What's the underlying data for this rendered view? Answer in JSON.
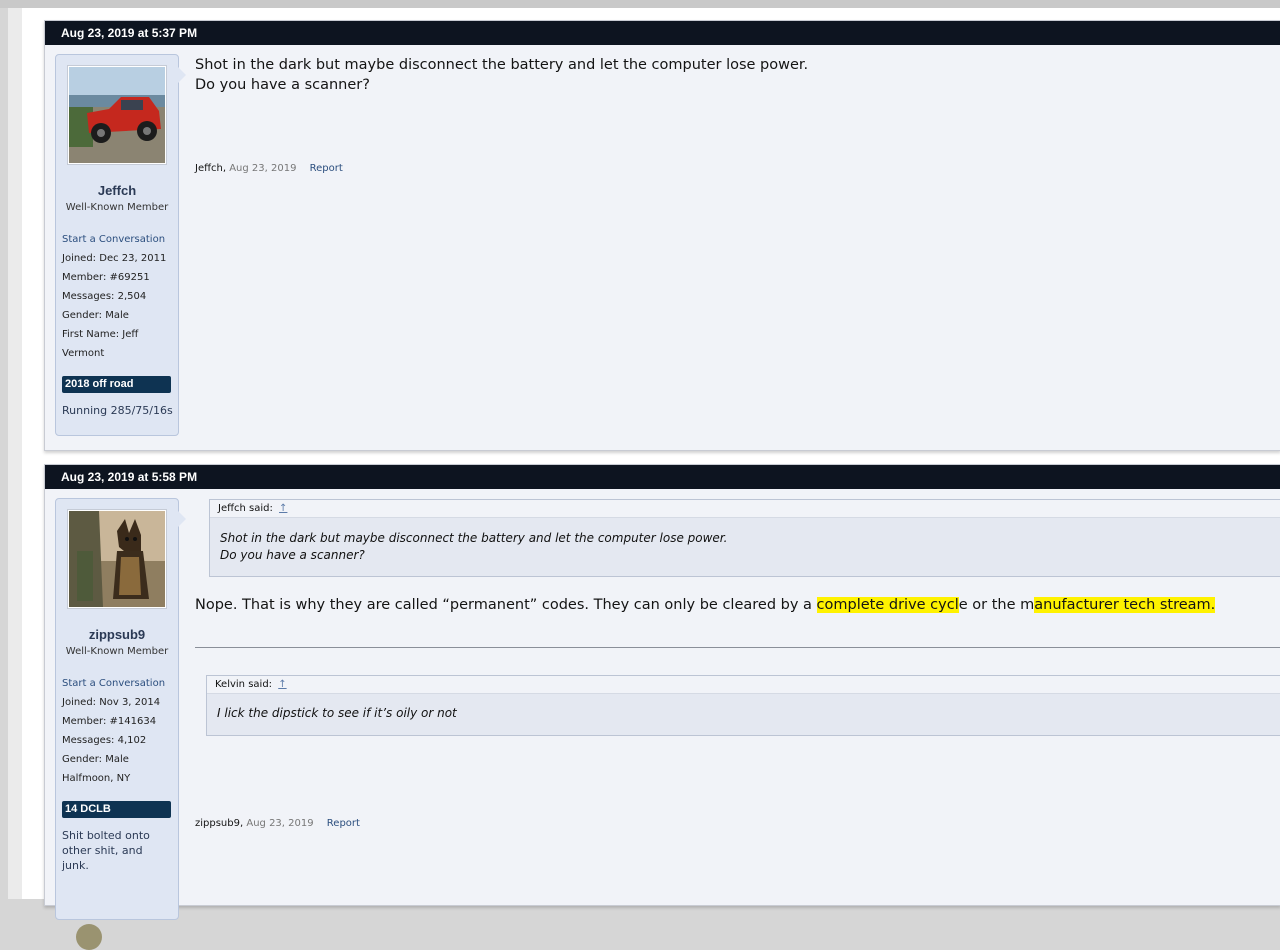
{
  "post1": {
    "timestamp": "Aug 23, 2019 at 5:37 PM",
    "user": {
      "name": "Jeffch",
      "title": "Well-Known Member",
      "start_conversation": "Start a Conversation",
      "fields": [
        {
          "label": "Joined:",
          "value": "Dec 23, 2011"
        },
        {
          "label": "Member:",
          "value": "#69251"
        },
        {
          "label": "Messages:",
          "value": "2,504"
        },
        {
          "label": "Gender:",
          "value": "Male"
        },
        {
          "label": "First Name:",
          "value": "Jeff"
        }
      ],
      "location": "Vermont",
      "banner": "2018 off road",
      "signature": "Running 285/75/16s"
    },
    "message_lines": [
      "Shot in the dark but maybe disconnect the battery and let the computer lose power.",
      "Do you have a scanner?"
    ],
    "meta": {
      "author": "Jeffch,",
      "date": "Aug 23, 2019",
      "report": "Report"
    }
  },
  "post2": {
    "timestamp": "Aug 23, 2019 at 5:58 PM",
    "user": {
      "name": "zippsub9",
      "title": "Well-Known Member",
      "start_conversation": "Start a Conversation",
      "fields": [
        {
          "label": "Joined:",
          "value": "Nov 3, 2014"
        },
        {
          "label": "Member:",
          "value": "#141634"
        },
        {
          "label": "Messages:",
          "value": "4,102"
        },
        {
          "label": "Gender:",
          "value": "Male"
        }
      ],
      "location": "Halfmoon, NY",
      "banner": "14 DCLB",
      "signature": "Shit bolted onto other shit, and junk."
    },
    "quote1": {
      "author": "Jeffch said:",
      "arrow": "↑",
      "lines": [
        "Shot in the dark but maybe disconnect the battery and let the computer lose power.",
        "Do you have a scanner?"
      ]
    },
    "reply": {
      "part1": "Nope. That is why they are called “permanent” codes. They can only be cleared by a ",
      "highlight1": "complete drive cycl",
      "part2": "e or the m",
      "highlight2": "anufacturer tech stream.",
      "part3": ""
    },
    "quote2": {
      "author": "Kelvin said:",
      "arrow": "↑",
      "text": "I lick the dipstick to see if it’s oily or not"
    },
    "meta": {
      "author": "zippsub9,",
      "date": "Aug 23, 2019",
      "report": "Report"
    }
  },
  "colors": {
    "header_bg": "#0d1420",
    "post_bg": "#f1f3f8",
    "userinfo_bg": "#dfe6f3",
    "banner_bg": "#0e3352",
    "highlight": "#fff200",
    "link": "#2b4e7e"
  }
}
